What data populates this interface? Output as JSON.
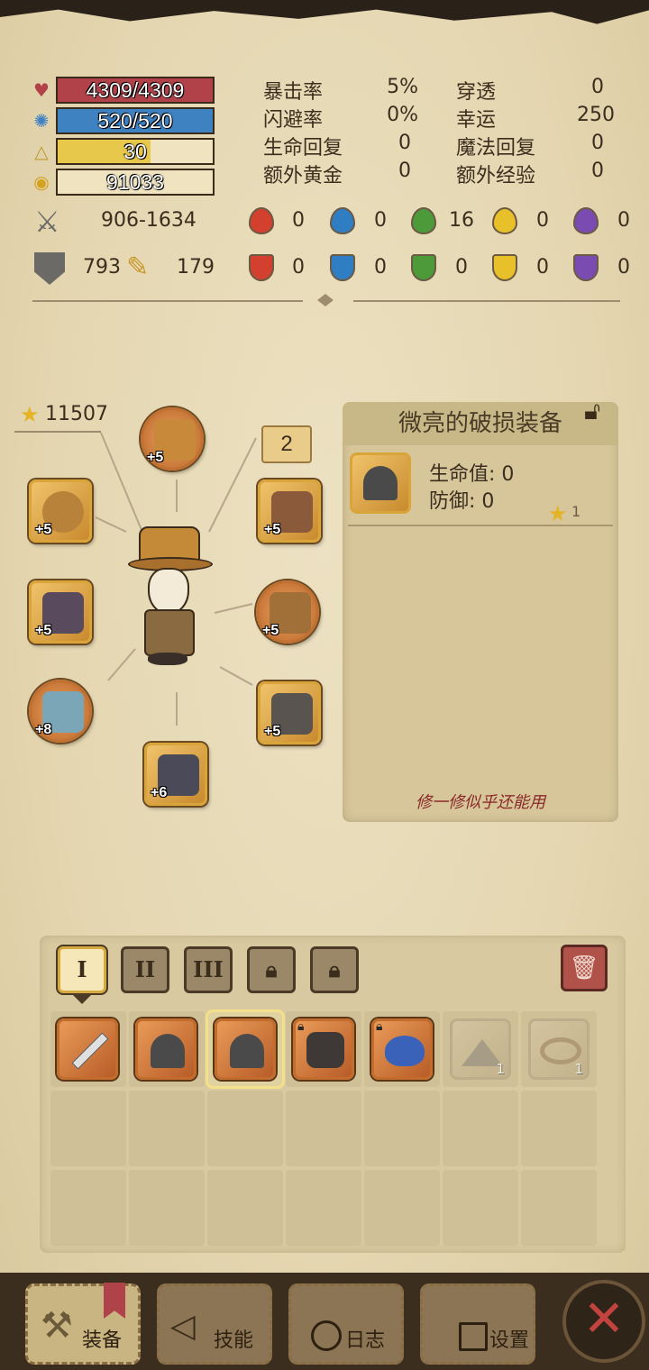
{
  "stats": {
    "hp": "4309/4309",
    "mp": "520/520",
    "level": "30",
    "gold": "91033",
    "attack": "906-1634",
    "defense": "793",
    "magic_def": "179"
  },
  "attributes": [
    {
      "label": "暴击率",
      "value": "5%"
    },
    {
      "label": "穿透",
      "value": "0"
    },
    {
      "label": "闪避率",
      "value": "0%"
    },
    {
      "label": "幸运",
      "value": "250"
    },
    {
      "label": "生命回复",
      "value": "0"
    },
    {
      "label": "魔法回复",
      "value": "0"
    },
    {
      "label": "额外黄金",
      "value": "0"
    },
    {
      "label": "额外经验",
      "value": "0"
    }
  ],
  "elements_attack": [
    "0",
    "0",
    "16",
    "0",
    "0"
  ],
  "elements_resist": [
    "0",
    "0",
    "0",
    "0",
    "0"
  ],
  "colors": {
    "hp_bar": "#b1424a",
    "mp_bar": "#3e82c2",
    "level_bar": "#e8c84a",
    "fire": "#d4402e",
    "water": "#2f7ec4",
    "nature": "#4c9a3a",
    "light": "#e8c02a",
    "dark": "#7a4bb0"
  },
  "equipment": {
    "gear_score": "11507",
    "tag": "2",
    "slots": [
      {
        "name": "helmet",
        "plus": "+5"
      },
      {
        "name": "ring",
        "plus": "+5"
      },
      {
        "name": "amulet",
        "plus": "+5"
      },
      {
        "name": "weapon",
        "plus": "+5"
      },
      {
        "name": "armor",
        "plus": "+5"
      },
      {
        "name": "bracer",
        "plus": "+8"
      },
      {
        "name": "gloves",
        "plus": "+5"
      },
      {
        "name": "boots",
        "plus": "+6"
      }
    ]
  },
  "detail": {
    "title": "微亮的破损装备",
    "hp": "生命值: 0",
    "def": "防御: 0",
    "stars": "1",
    "flavor": "修一修似乎还能用"
  },
  "inventory": {
    "tabs": [
      "I",
      "II",
      "III",
      "",
      ""
    ],
    "items": [
      {
        "name": "sword"
      },
      {
        "name": "broken-gear"
      },
      {
        "name": "broken-gear"
      },
      {
        "name": "gauntlet"
      },
      {
        "name": "feather-boa"
      },
      {
        "name": "sand-pile",
        "count": "1"
      },
      {
        "name": "horn",
        "count": "1"
      }
    ]
  },
  "nav": {
    "equip": "装备",
    "skill": "技能",
    "log": "日志",
    "settings": "设置"
  }
}
